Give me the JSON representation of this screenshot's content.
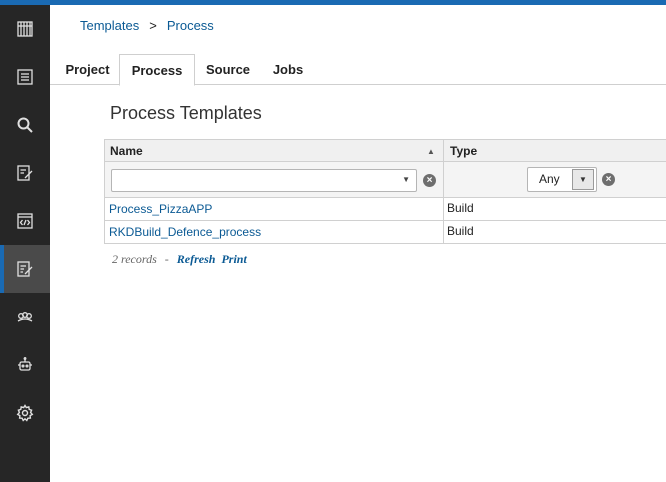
{
  "sidebar": {
    "items": [
      {
        "icon": "building-icon",
        "active": false
      },
      {
        "icon": "list-icon",
        "active": false
      },
      {
        "icon": "search-icon",
        "active": false
      },
      {
        "icon": "edit-document-icon",
        "active": false
      },
      {
        "icon": "code-window-icon",
        "active": false
      },
      {
        "icon": "template-edit-icon",
        "active": true
      },
      {
        "icon": "group-icon",
        "active": false
      },
      {
        "icon": "robot-icon",
        "active": false
      },
      {
        "icon": "gear-icon",
        "active": false
      }
    ]
  },
  "breadcrumb": {
    "items": [
      "Templates",
      "Process"
    ],
    "separator": ">"
  },
  "tabs": [
    {
      "label": "Project",
      "active": false
    },
    {
      "label": "Process",
      "active": true
    },
    {
      "label": "Source",
      "active": false
    },
    {
      "label": "Jobs",
      "active": false
    }
  ],
  "page_title": "Process Templates",
  "grid": {
    "columns": {
      "name": "Name",
      "type": "Type"
    },
    "filters": {
      "name_value": "",
      "type_value": "Any"
    },
    "rows": [
      {
        "name": "Process_PizzaAPP",
        "type": "Build"
      },
      {
        "name": "RKDBuild_Defence_process",
        "type": "Build"
      }
    ]
  },
  "footer": {
    "count": "2 records",
    "dash": "-",
    "refresh": "Refresh",
    "print": "Print"
  },
  "colors": {
    "accent": "#1a6ab3",
    "link": "#0b5a94",
    "sidebar": "#262626",
    "sidebar_active": "#4a4a4a"
  }
}
